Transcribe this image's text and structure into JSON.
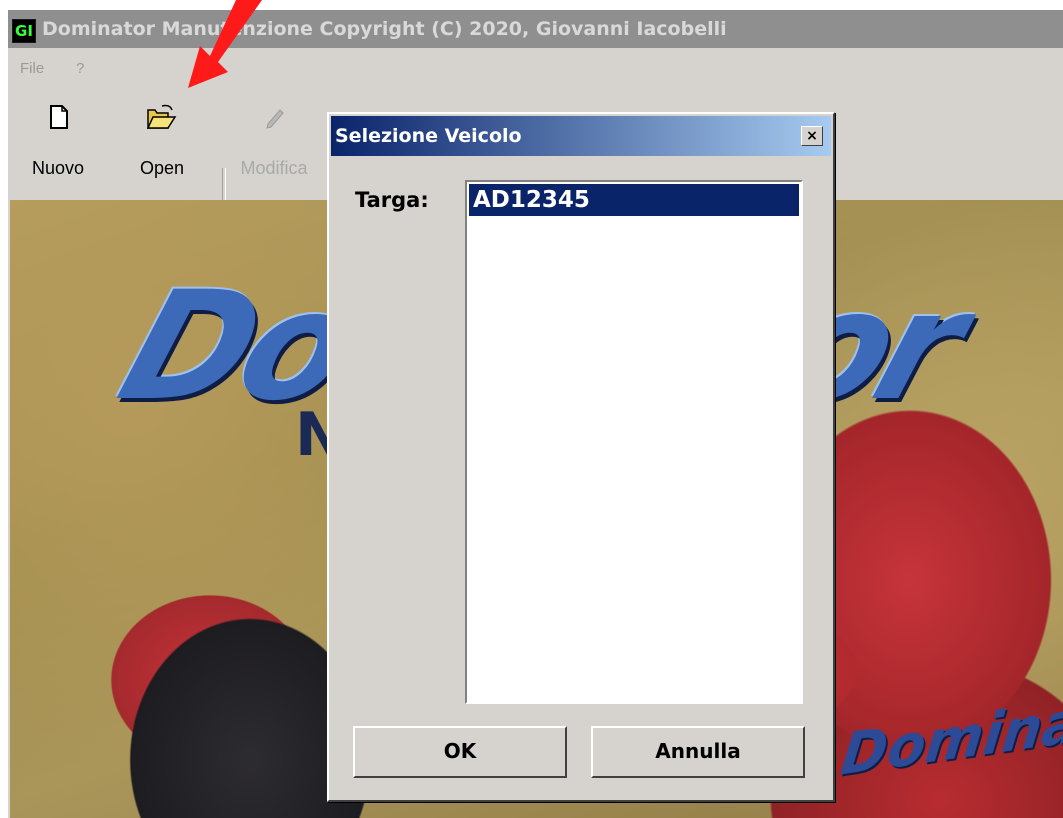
{
  "window": {
    "app_icon": "GI",
    "title": "Dominator Manutenzione Copyright (C) 2020, Giovanni Iacobelli"
  },
  "menu": {
    "items": [
      "File",
      "?"
    ]
  },
  "toolbar": {
    "buttons": [
      {
        "label": "Nuovo",
        "icon": "new-document-icon",
        "enabled": true
      },
      {
        "label": "Open",
        "icon": "open-folder-icon",
        "enabled": true
      },
      {
        "label": "Modifica",
        "icon": "pencil-icon",
        "enabled": false
      }
    ]
  },
  "background": {
    "logo_text": "Dominator",
    "side_text": "Dominator"
  },
  "dialog": {
    "title": "Selezione Veicolo",
    "close_label": "×",
    "targa_label": "Targa:",
    "list_items": [
      "AD12345"
    ],
    "selected_index": 0,
    "ok_label": "OK",
    "cancel_label": "Annulla"
  },
  "annotation": {
    "arrow_color": "#ff1a1a"
  }
}
